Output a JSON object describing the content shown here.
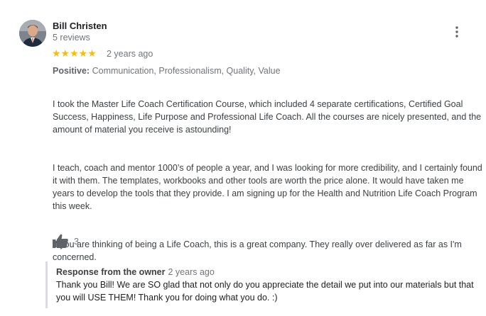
{
  "reviewer": {
    "name": "Bill Christen",
    "review_count": "5 reviews"
  },
  "rating": {
    "stars": "★★★★★",
    "value": 5,
    "max": 5,
    "time": "2 years ago",
    "star_color": "#fbbc04"
  },
  "positive": {
    "label": "Positive:",
    "tags": "Communication, Professionalism, Quality, Value"
  },
  "review_paragraphs": [
    "I took the Master Life Coach Certification Course, which included 4 separate certifications, Certified Goal Success, Happiness, Life Purpose and Professional Life Coach.  All the courses are nicely presented, and the amount of material you receive is astounding!",
    "I teach, coach and mentor 1000’s of people a year, and I was looking for more credibility, and I certainly found it with them.  The templates, workbooks and other tools are worth the price alone.  It would have taken me years to develop the tools that they provide.  I am signing up for the Health and Nutrition Life Coach Program this week.",
    "If you are thinking of being a Life Coach, this is a great company.  They really over delivered as far as I'm concerned."
  ],
  "likes": {
    "icon": "thumbs-up-icon",
    "count": "3"
  },
  "owner_response": {
    "title": "Response from the owner",
    "time": "2 years ago",
    "text": "Thank you Bill! We are SO glad that not only do you appreciate the detail we put into our materials but that you will USE THEM! Thank you for doing what you do. :)"
  },
  "menu": {
    "icon": "more-vert-icon"
  }
}
